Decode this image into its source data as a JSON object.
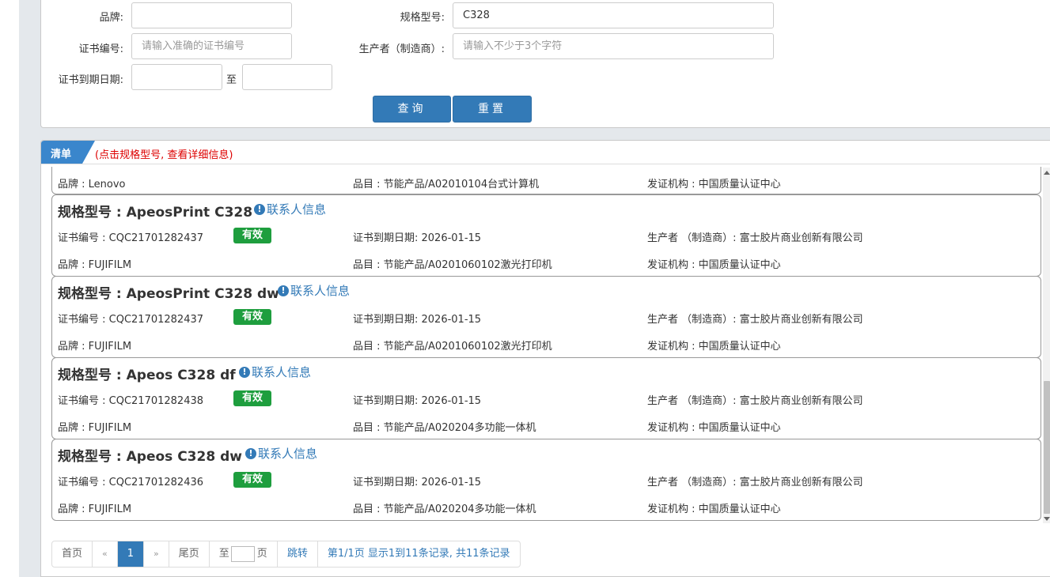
{
  "search": {
    "brand_label": "品牌:",
    "brand_value": "",
    "model_label": "规格型号:",
    "model_value": "C328",
    "cert_no_label": "证书编号:",
    "cert_no_placeholder": "请输入准确的证书编号",
    "manufacturer_label": "生产者（制造商）:",
    "manufacturer_placeholder": "请输入不少于3个字符",
    "expiry_label": "证书到期日期:",
    "expiry_from": "",
    "expiry_to_sep": "至",
    "expiry_to": "",
    "query_button": "查询",
    "reset_button": "重置"
  },
  "list": {
    "tab_label": "清单",
    "hint": "(点击规格型号, 查看详细信息)",
    "partial_record": {
      "brand": "品牌 : Lenovo",
      "category": "品目 : 节能产品/A02010104台式计算机",
      "issuer": "发证机构 : 中国质量认证中心"
    },
    "records": [
      {
        "model": "规格型号 : ApeosPrint C328",
        "contact": "联系人信息",
        "cert_no": "证书编号 : CQC21701282437",
        "status": "有效",
        "expiry": "证书到期日期: 2026-01-15",
        "manufacturer": "生产者 （制造商）: 富士胶片商业创新有限公司",
        "brand": "品牌 : FUJIFILM",
        "category": "品目 : 节能产品/A0201060102激光打印机",
        "issuer": "发证机构 : 中国质量认证中心"
      },
      {
        "model": "规格型号 : ApeosPrint C328 dw",
        "contact": "联系人信息",
        "cert_no": "证书编号 : CQC21701282437",
        "status": "有效",
        "expiry": "证书到期日期: 2026-01-15",
        "manufacturer": "生产者 （制造商）: 富士胶片商业创新有限公司",
        "brand": "品牌 : FUJIFILM",
        "category": "品目 : 节能产品/A0201060102激光打印机",
        "issuer": "发证机构 : 中国质量认证中心"
      },
      {
        "model": "规格型号 : Apeos C328 df",
        "contact": "联系人信息",
        "cert_no": "证书编号 : CQC21701282438",
        "status": "有效",
        "expiry": "证书到期日期: 2026-01-15",
        "manufacturer": "生产者 （制造商）: 富士胶片商业创新有限公司",
        "brand": "品牌 : FUJIFILM",
        "category": "品目 : 节能产品/A020204多功能一体机",
        "issuer": "发证机构 : 中国质量认证中心"
      },
      {
        "model": "规格型号 : Apeos C328 dw",
        "contact": "联系人信息",
        "cert_no": "证书编号 : CQC21701282436",
        "status": "有效",
        "expiry": "证书到期日期: 2026-01-15",
        "manufacturer": "生产者 （制造商）: 富士胶片商业创新有限公司",
        "brand": "品牌 : FUJIFILM",
        "category": "品目 : 节能产品/A020204多功能一体机",
        "issuer": "发证机构 : 中国质量认证中心"
      }
    ]
  },
  "pager": {
    "first": "首页",
    "prev": "«",
    "current": "1",
    "next": "»",
    "last": "尾页",
    "goto_prefix": "至",
    "goto_suffix": "页",
    "jump": "跳转",
    "summary": "第1/1页  显示1到11条记录, 共11条记录"
  },
  "colors": {
    "primary": "#337ab7",
    "valid_badge": "#1e9e3e",
    "hint_red": "#dd0000"
  }
}
